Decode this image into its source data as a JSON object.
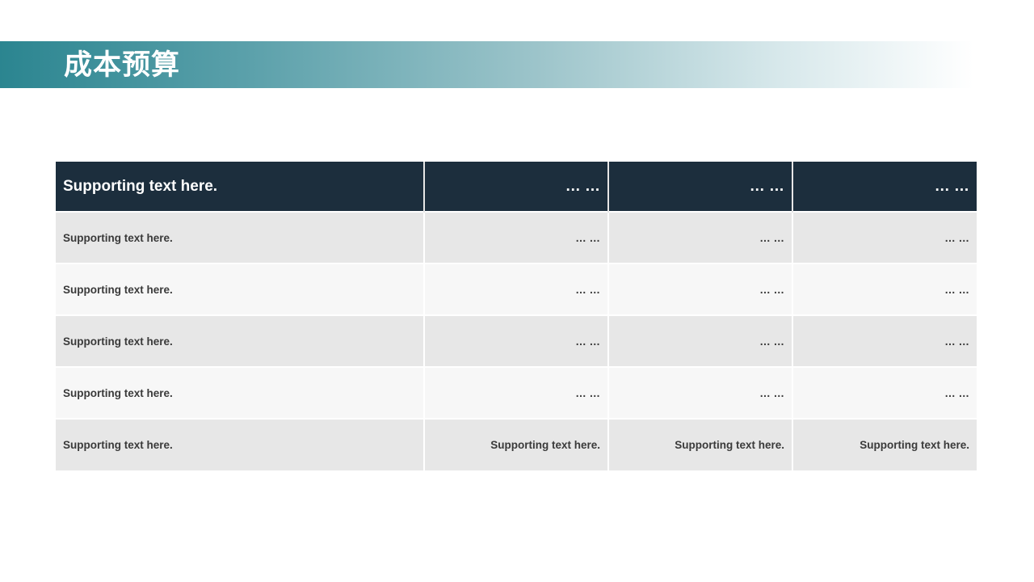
{
  "title": "成本预算",
  "table": {
    "header": [
      "Supporting text here.",
      "… …",
      "… …",
      "… …"
    ],
    "rows": [
      [
        "Supporting text here.",
        "… …",
        "… …",
        "… …"
      ],
      [
        "Supporting text here.",
        "… …",
        "… …",
        "… …"
      ],
      [
        "Supporting text here.",
        "… …",
        "… …",
        "… …"
      ],
      [
        "Supporting text here.",
        "… …",
        "… …",
        "… …"
      ],
      [
        "Supporting text here.",
        "Supporting text here.",
        "Supporting text here.",
        "Supporting text here."
      ]
    ]
  },
  "colors": {
    "header_bg": "#1c2e3d",
    "title_gradient_start": "#2b8590",
    "row_odd": "#e7e7e7",
    "row_even": "#f7f7f7"
  }
}
